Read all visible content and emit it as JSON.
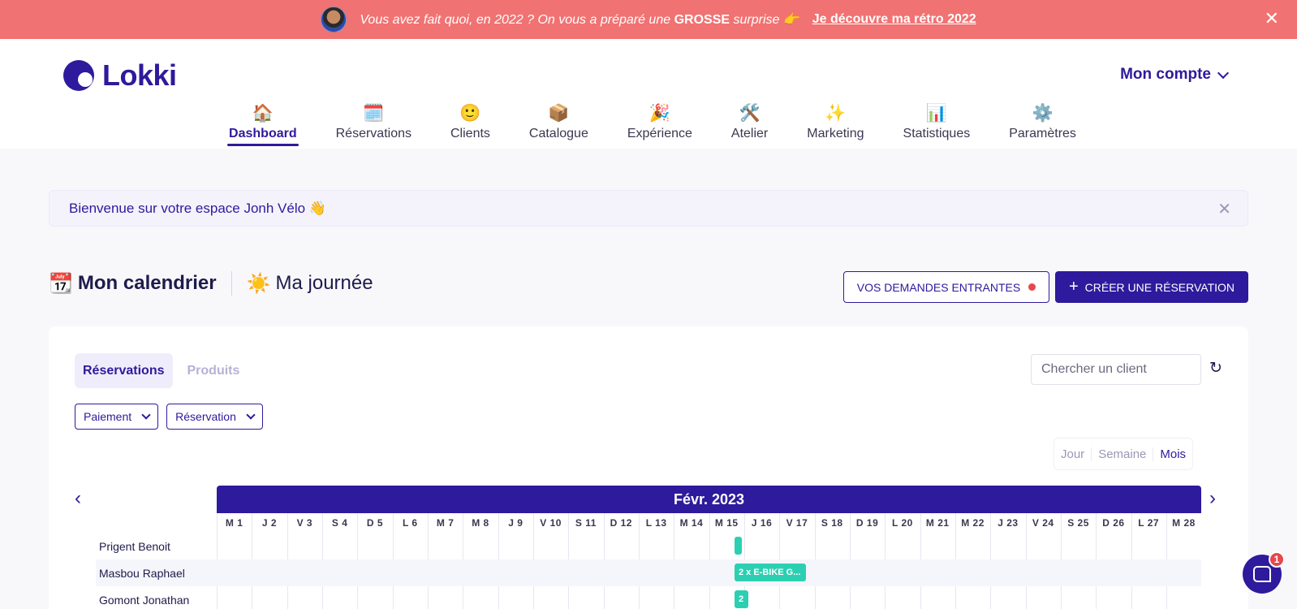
{
  "banner": {
    "message_pre": "Vous avez fait quoi, en 2022 ? On vous a préparé une ",
    "message_bold": "GROSSE",
    "message_post": " surprise 👉",
    "cta": "Je découvre ma rétro 2022",
    "close": "✕",
    "color": "#f17272"
  },
  "brand": {
    "name": "Lokki",
    "color": "#2e1a9c"
  },
  "account": {
    "label": "Mon compte"
  },
  "nav": [
    {
      "icon": "🏠",
      "label": "Dashboard",
      "active": true
    },
    {
      "icon": "🗓️",
      "label": "Réservations"
    },
    {
      "icon": "🙂",
      "label": "Clients"
    },
    {
      "icon": "📦",
      "label": "Catalogue"
    },
    {
      "icon": "🎉",
      "label": "Expérience"
    },
    {
      "icon": "🛠️",
      "label": "Atelier"
    },
    {
      "icon": "✨",
      "label": "Marketing"
    },
    {
      "icon": "📊",
      "label": "Statistiques"
    },
    {
      "icon": "⚙️",
      "label": "Paramètres"
    }
  ],
  "welcome": {
    "text": "Bienvenue sur votre espace Jonh Vélo 👋",
    "close": "✕"
  },
  "calendar_header": {
    "title_icon": "📆",
    "title": "Mon calendrier",
    "day_icon": "☀️",
    "day_label": "Ma journée",
    "incoming_btn": "VOS DEMANDES ENTRANTES",
    "create_btn": "CRÉER UNE RÉSERVATION"
  },
  "tabs": {
    "reservations": "Réservations",
    "products": "Produits"
  },
  "search": {
    "placeholder": "Chercher un client"
  },
  "filters": {
    "payment": "Paiement",
    "reservation": "Réservation"
  },
  "views": {
    "day": "Jour",
    "week": "Semaine",
    "month": "Mois"
  },
  "calendar": {
    "month": "Févr. 2023",
    "days": [
      "M 1",
      "J 2",
      "V 3",
      "S 4",
      "D 5",
      "L 6",
      "M 7",
      "M 8",
      "J 9",
      "V 10",
      "S 11",
      "D 12",
      "L 13",
      "M 14",
      "M 15",
      "J 16",
      "V 17",
      "S 18",
      "D 19",
      "L 20",
      "M 21",
      "M 22",
      "J 23",
      "V 24",
      "S 25",
      "D 26",
      "L 27",
      "M 28"
    ],
    "rows": [
      {
        "name": "Prigent Benoit",
        "event": ""
      },
      {
        "name": "Masbou Raphael",
        "event": "2 x E-BIKE G..."
      },
      {
        "name": "Gomont Jonathan",
        "event": "2"
      }
    ],
    "event_color": "#2ccfb1"
  },
  "chat": {
    "badge": "1"
  }
}
